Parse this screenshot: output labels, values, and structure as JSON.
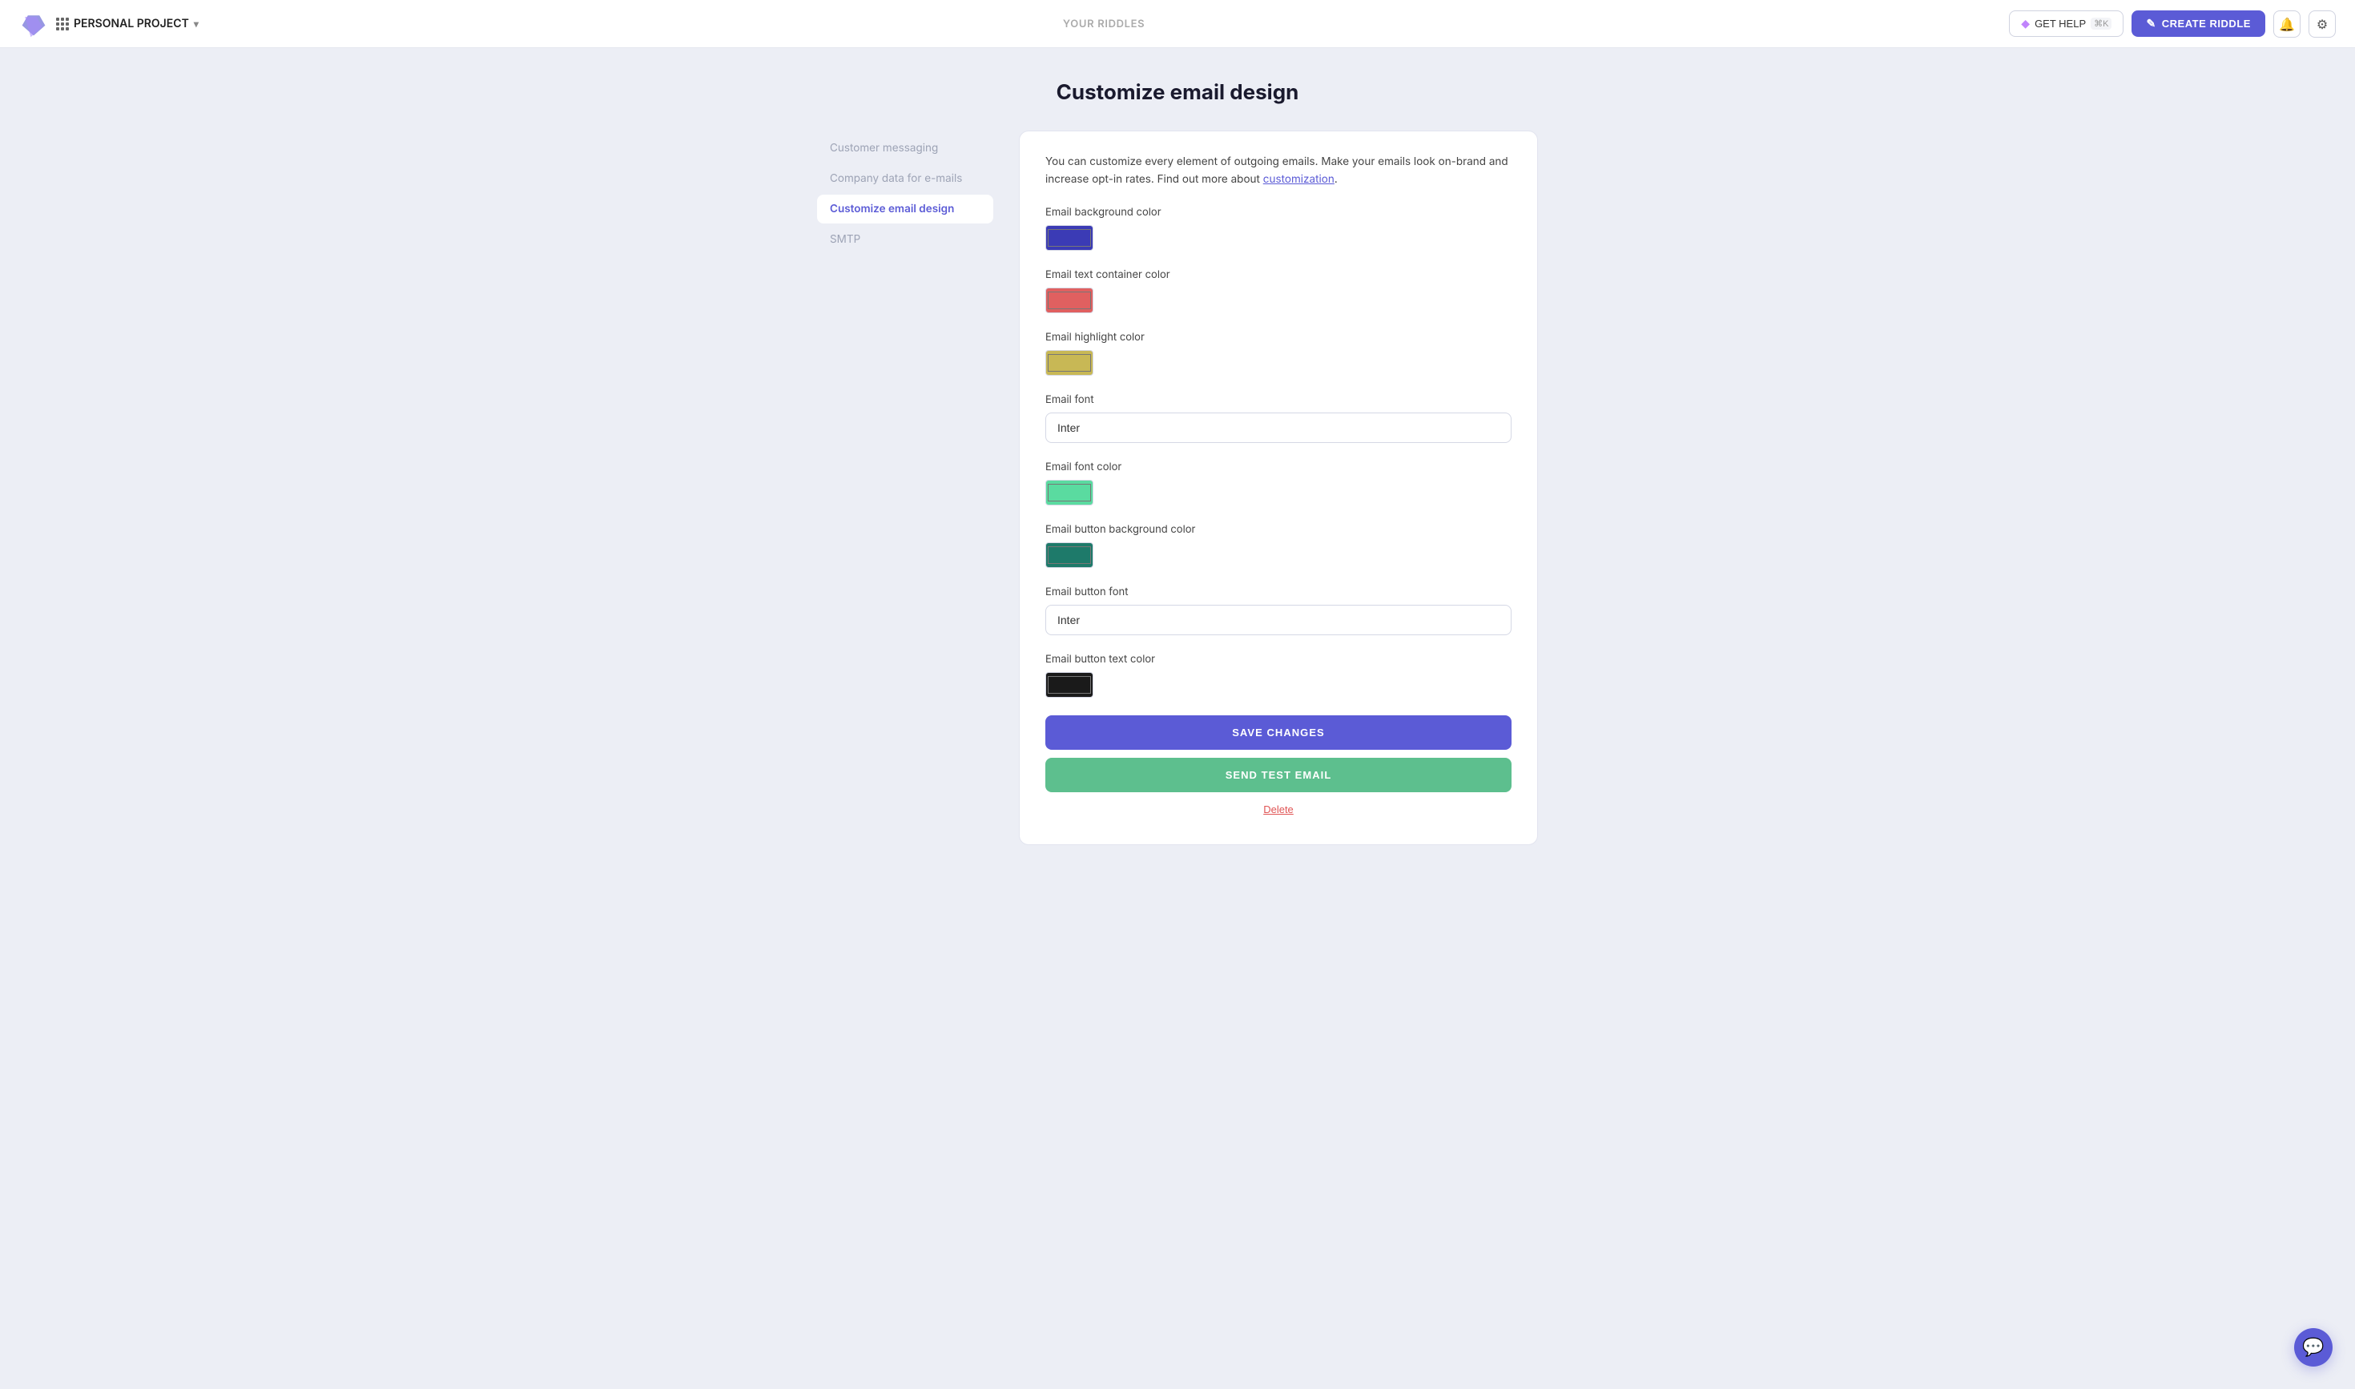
{
  "header": {
    "project_name": "PERSONAL PROJECT",
    "nav_center": "YOUR RIDDLES",
    "get_help_label": "GET HELP",
    "get_help_kbd": "⌘K",
    "create_riddle_label": "CREATE RIDDLE"
  },
  "page": {
    "title": "Customize email design"
  },
  "sidebar": {
    "items": [
      {
        "id": "customer-messaging",
        "label": "Customer messaging",
        "active": false
      },
      {
        "id": "company-data",
        "label": "Company data for e-mails",
        "active": false
      },
      {
        "id": "customize-email",
        "label": "Customize email design",
        "active": true
      },
      {
        "id": "smtp",
        "label": "SMTP",
        "active": false
      }
    ]
  },
  "form": {
    "info_text": "You can customize every element of outgoing emails. Make your emails look on-brand and increase opt-in rates. Find out more about ",
    "info_link_text": "customization",
    "info_link_url": "#",
    "fields": [
      {
        "id": "bg-color",
        "label": "Email background color",
        "type": "color",
        "value": "#3b3bb5"
      },
      {
        "id": "text-container-color",
        "label": "Email text container color",
        "type": "color",
        "value": "#e06060"
      },
      {
        "id": "highlight-color",
        "label": "Email highlight color",
        "type": "color",
        "value": "#c8b855"
      },
      {
        "id": "font",
        "label": "Email font",
        "type": "text",
        "value": "Inter"
      },
      {
        "id": "font-color",
        "label": "Email font color",
        "type": "color",
        "value": "#5adba0"
      },
      {
        "id": "btn-bg-color",
        "label": "Email button background color",
        "type": "color",
        "value": "#1e7a6a"
      },
      {
        "id": "btn-font",
        "label": "Email button font",
        "type": "text",
        "value": "Inter"
      },
      {
        "id": "btn-text-color",
        "label": "Email button text color",
        "type": "color",
        "value": "#1a1a1a"
      }
    ],
    "save_label": "SAVE CHANGES",
    "send_test_label": "SEND TEST EMAIL",
    "delete_label": "Delete"
  },
  "chat": {
    "icon": "💬"
  }
}
